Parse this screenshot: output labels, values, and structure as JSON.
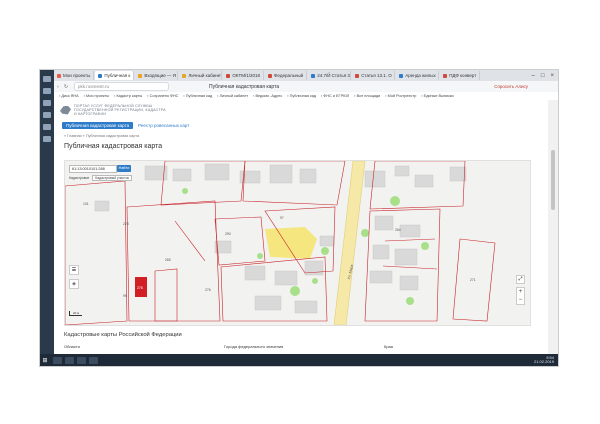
{
  "browser": {
    "tabs": [
      {
        "label": "Мои проекты",
        "color": "#e35d4a",
        "active": false
      },
      {
        "label": "Публичная к",
        "color": "#2e7cc9",
        "active": true
      },
      {
        "label": "Входящие — Я",
        "color": "#f0a020",
        "active": false
      },
      {
        "label": "Личный кабинет",
        "color": "#e3a72a",
        "active": false
      },
      {
        "label": "ОКТМ/1/2018",
        "color": "#d04a3a",
        "active": false
      },
      {
        "label": "Федеральный",
        "color": "#d04a3a",
        "active": false
      },
      {
        "label": "24.7/Й Статья 3",
        "color": "#2e7cc9",
        "active": false
      },
      {
        "label": "Статья 13.1. О",
        "color": "#d04a3a",
        "active": false
      },
      {
        "label": "Аренда жилых",
        "color": "#2e7cc9",
        "active": false
      },
      {
        "label": "ПДФ конверт",
        "color": "#d04a3a",
        "active": false
      }
    ],
    "url": "pkk.rosreestr.ru",
    "page_title": "Публичная кадастровая карта",
    "assistant": "Спросить Алису",
    "bookmarks": [
      "Диск ЯНА",
      "Мои проекты",
      "Кадастр карты",
      "Сохранено ФНС",
      "Публичная кад",
      "Личный кабинет",
      "Ведомо -Адрес",
      "Публичная кад",
      "ФНС и ЕГРЮЛ",
      "Все площади",
      "Мой Ростреестр",
      "Единые Выписки"
    ]
  },
  "site": {
    "logo_line1": "ПОРТАЛ УСЛУГ ФЕДЕРАЛЬНОЙ СЛУЖБЫ",
    "logo_line2": "ГОСУДАРСТВЕННОЙ РЕГИСТРАЦИИ, КАДАСТРА",
    "logo_line3": "И КАРТОГРАФИИ",
    "tab_active": "Публичная кадастровая карта",
    "tab_link": "Реестр ровесанных карт",
    "breadcrumbs": "«  Главная  »  Публичная кадастровая карта",
    "page_heading": "Публичная кадастровая карта",
    "search_value": "61:13:0010101:288",
    "find_button": "Найти",
    "filter_label": "Кадастровое",
    "filter_select": "Кадастровый участок",
    "street_label": "Ул. Мира",
    "scale_label": "20 м",
    "zoom_in": "+",
    "zoom_out": "−",
    "parcel_labels": [
      "101",
      "228",
      "265",
      "99",
      "278",
      "290",
      "97",
      "264",
      "271",
      "276"
    ],
    "footer_heading": "Кадастровые карты Российской Федерации",
    "footer_col1": "Области",
    "footer_col2": "Города федерального значения",
    "footer_col3": "Края"
  },
  "taskbar": {
    "time": "9:54",
    "date": "21.02.2019"
  },
  "colors": {
    "accent": "#2e7cc9",
    "parcel_border": "#c8242a",
    "selected_parcel": "#d21f26",
    "highlight": "#f6e25a"
  }
}
